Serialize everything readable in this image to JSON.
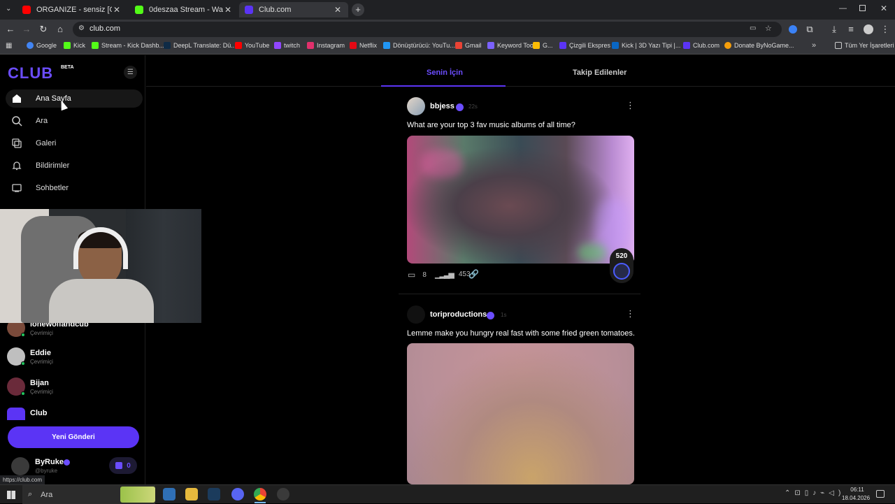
{
  "browser": {
    "tabs": [
      {
        "title": "ORGANIZE - sensiz [OFFICIAL M...",
        "color": "#ff0000"
      },
      {
        "title": "0deszaa Stream - Watch Live on...",
        "color": "#53fc18"
      },
      {
        "title": "Club.com",
        "color": "#5b34f5"
      }
    ],
    "url": "club.com",
    "bookmarks": [
      {
        "label": "Google",
        "color": "#4285f4"
      },
      {
        "label": "Kick",
        "color": "#53fc18"
      },
      {
        "label": "Stream - Kick Dashb...",
        "color": "#53fc18"
      },
      {
        "label": "DeepL Translate: Dü...",
        "color": "#0f2b46"
      },
      {
        "label": "YouTube",
        "color": "#ff0000"
      },
      {
        "label": "twitch",
        "color": "#9146ff"
      },
      {
        "label": "Instagram",
        "color": "#e1306c"
      },
      {
        "label": "Netflix",
        "color": "#e50914"
      },
      {
        "label": "Dönüştürücü: YouTu...",
        "color": "#2196f3"
      },
      {
        "label": "Gmail",
        "color": "#ea4335"
      },
      {
        "label": "Keyword Tool",
        "color": "#7b61ff"
      },
      {
        "label": "G...",
        "color": "#fbbc05"
      },
      {
        "label": "Çizgili Ekspres",
        "color": "#5b34f5"
      },
      {
        "label": "Kick | 3D Yazı Tipi |...",
        "color": "#0a66c2"
      },
      {
        "label": "Club.com",
        "color": "#5b34f5"
      },
      {
        "label": "Donate ByNoGame...",
        "color": "#f59e0b"
      }
    ],
    "bookmarks_all": "Tüm Yer İşaretleri",
    "status_url": "https://club.com"
  },
  "sidebar": {
    "logo": "CLUB",
    "beta": "BETA",
    "nav": [
      {
        "label": "Ana Sayfa"
      },
      {
        "label": "Ara"
      },
      {
        "label": "Galeri"
      },
      {
        "label": "Bildirimler"
      },
      {
        "label": "Sohbetler"
      }
    ],
    "friends": [
      {
        "name": "lonewolfandcub",
        "status": "Çevrimiçi"
      },
      {
        "name": "Eddie",
        "status": "Çevrimiçi"
      },
      {
        "name": "Bijan",
        "status": "Çevrimiçi"
      },
      {
        "name": "Club",
        "status": ""
      }
    ],
    "new_post": "Yeni Gönderi",
    "user": {
      "name": "ByRuke",
      "handle": "@byruke",
      "coins": "0"
    }
  },
  "feed": {
    "tabs": [
      "Senin İçin",
      "Takip Edilenler"
    ],
    "posts": [
      {
        "user": "bbjess",
        "time": "22s",
        "text": "What are your top 3 fav music albums of all time?",
        "comments": "8",
        "views": "453",
        "badge": "520"
      },
      {
        "user": "toriproductions",
        "time": "1s",
        "text": "Lemme make you hungry real fast with some fried green tomatoes."
      }
    ]
  },
  "taskbar": {
    "search": "Ara",
    "time": "06:11",
    "date": "18.04.2026"
  }
}
